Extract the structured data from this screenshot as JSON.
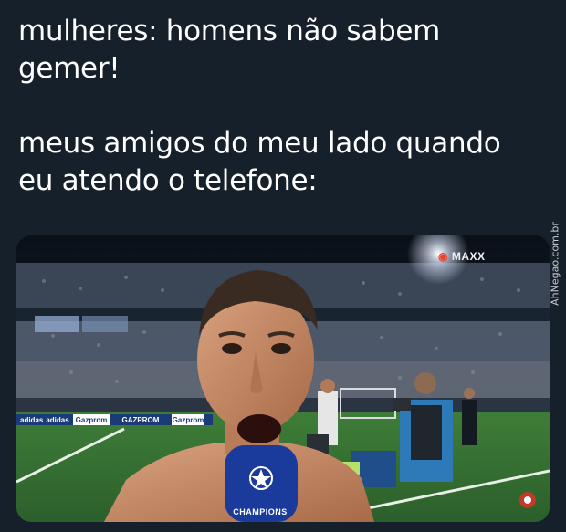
{
  "caption": {
    "line1": "mulheres: homens não sabem",
    "line2": "gemer!",
    "line3": "meus amigos do meu lado quando",
    "line4": "eu atendo o telefone:"
  },
  "image": {
    "watermark": "AhNegao.com.br",
    "broadcast_logo": "MAXX",
    "ad_board": [
      "adidas",
      "adidas",
      "Gazprom",
      "GAZPROM",
      "Gazprom"
    ],
    "mic_text": "CHAMPIONS"
  }
}
